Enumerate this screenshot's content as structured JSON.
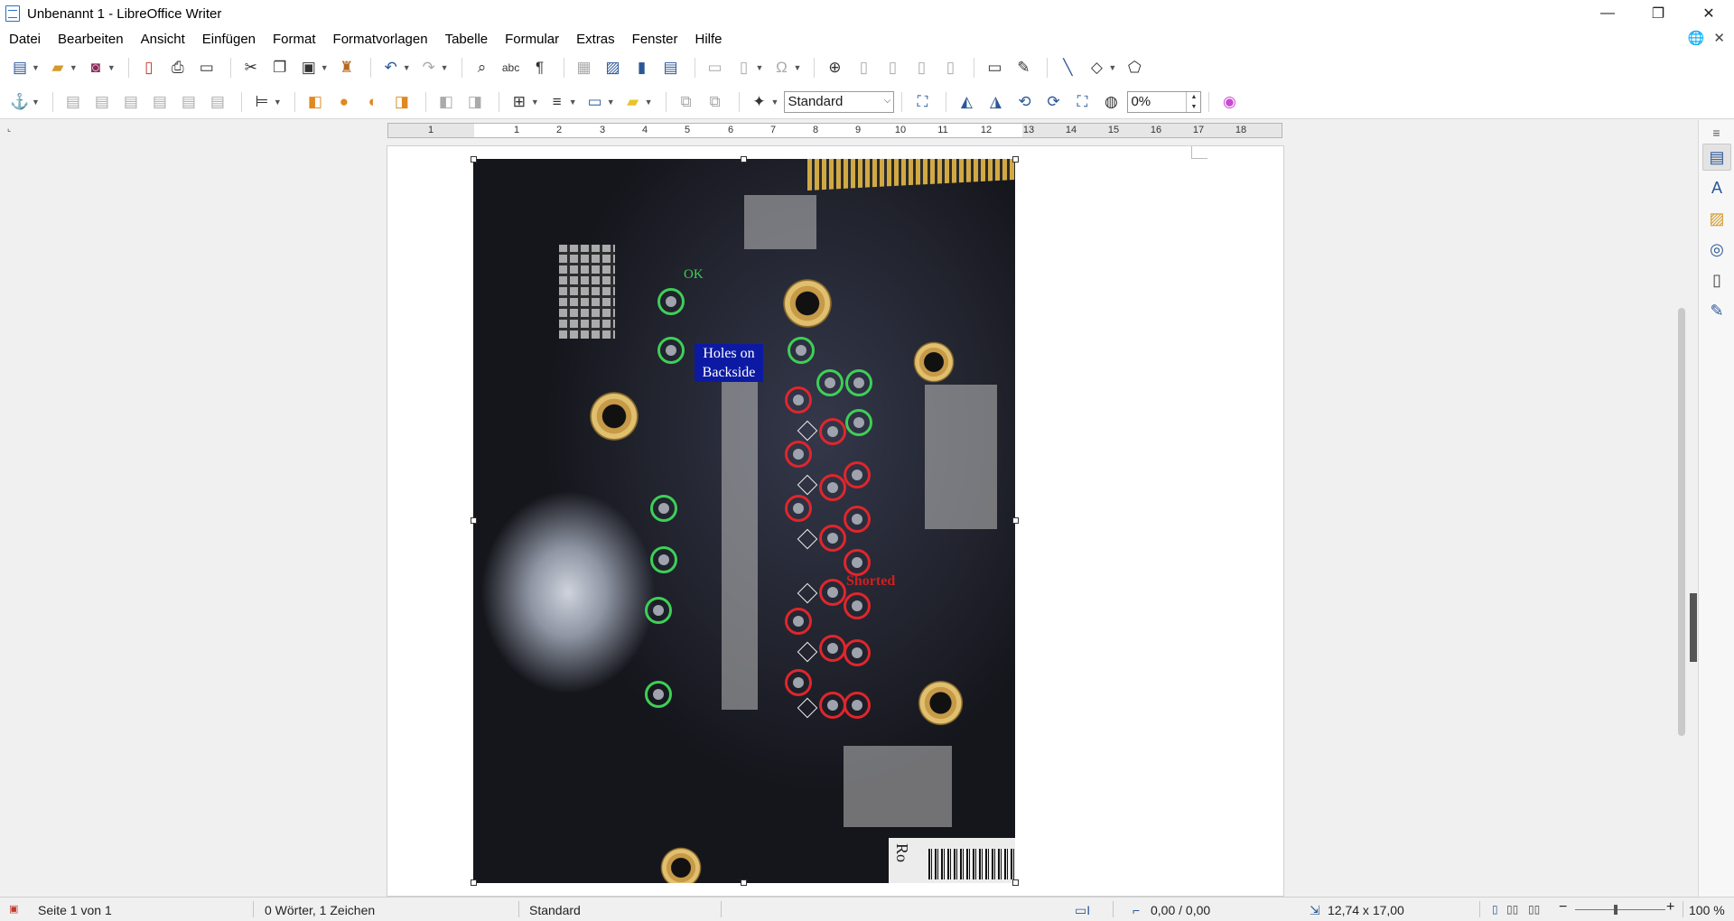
{
  "window": {
    "title": "Unbenannt 1 - LibreOffice Writer",
    "minimize": "—",
    "maximize": "❐",
    "close": "✕"
  },
  "menu": {
    "items": [
      "Datei",
      "Bearbeiten",
      "Ansicht",
      "Einfügen",
      "Format",
      "Formatvorlagen",
      "Tabelle",
      "Formular",
      "Extras",
      "Fenster",
      "Hilfe"
    ],
    "globe_icon": "🌐",
    "close_doc": "✕"
  },
  "toolbar1": {
    "icons": [
      "new-icon",
      "open-icon",
      "save-icon",
      "export-pdf-icon",
      "print-icon",
      "print-preview-icon",
      "cut-icon",
      "copy-icon",
      "paste-icon",
      "clone-formatting-icon",
      "undo-icon",
      "redo-icon",
      "find-replace-icon",
      "spelling-icon",
      "formatting-marks-icon",
      "table-icon",
      "image-icon",
      "chart-icon",
      "textbox-icon",
      "page-break-icon",
      "field-icon",
      "special-character-icon",
      "hyperlink-icon",
      "footnote-icon",
      "endnote-icon",
      "bookmark-icon",
      "cross-reference-icon",
      "comment-icon",
      "track-changes-icon",
      "line-icon",
      "shapes-icon",
      "draw-functions-icon"
    ]
  },
  "toolbar2": {
    "style_value": "Standard",
    "rotation_value": "0%"
  },
  "ruler": {
    "labels": [
      "1",
      "1",
      "2",
      "3",
      "4",
      "5",
      "6",
      "7",
      "8",
      "9",
      "10",
      "11",
      "12",
      "13",
      "14",
      "15",
      "16",
      "17",
      "18"
    ]
  },
  "image": {
    "label_ok": "OK",
    "label_holes_line1": "Holes on",
    "label_holes_line2": "Backside",
    "label_shorted": "Shorted",
    "sticker_text": "Ro"
  },
  "status": {
    "page": "Seite 1 von 1",
    "words": "0 Wörter, 1 Zeichen",
    "page_style": "Standard",
    "position": "0,00 / 0,00",
    "size": "12,74 x 17,00",
    "zoom": "100 %"
  },
  "colors": {
    "accent": "#2b5797",
    "mark_ok": "#3ecf57",
    "mark_shorted": "#e0262c",
    "label_bg": "#0c1aa3"
  }
}
